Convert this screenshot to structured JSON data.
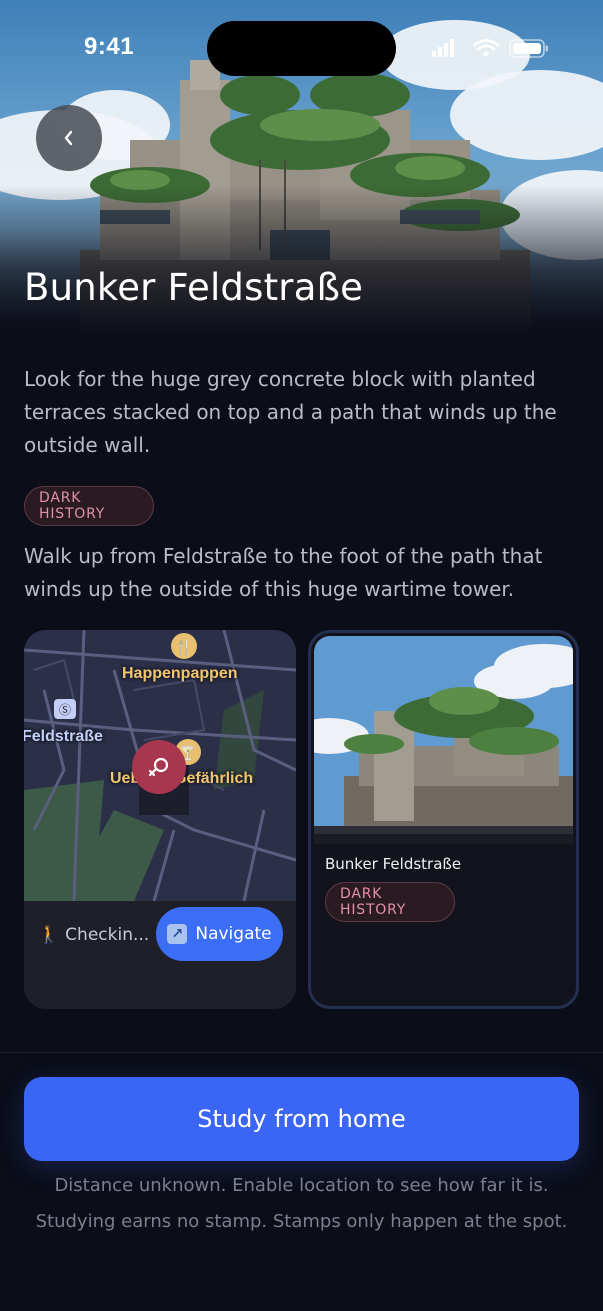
{
  "status_bar": {
    "time": "9:41"
  },
  "hero": {
    "title": "Bunker Feldstraße",
    "back_icon": "chevron-left-icon"
  },
  "description": "Look for the huge grey concrete block with planted terraces stacked on top and a path that winds up the outside wall.",
  "category_tag": "DARK HISTORY",
  "directions": "Walk up from Feldstraße to the foot of the path that winds up the outside of this huge wartime tower.",
  "map_card": {
    "labels": {
      "restaurant": "Happenpappen",
      "station": "Feldstraße",
      "bar": "Uebel & Gefährlich"
    },
    "checkin_label": "Checkin...",
    "navigate_label": "Navigate"
  },
  "photo_card": {
    "caption": "Bunker Feldstraße",
    "tag": "DARK HISTORY"
  },
  "cta": {
    "study_label": "Study from home",
    "footnote": "Distance unknown. Enable location to see how far it is. Studying earns no stamp. Stamps only happen at the spot."
  },
  "colors": {
    "background": "#0b0d18",
    "accent": "#3b66f5",
    "tag_text": "#e092a6",
    "tag_border": "#5c3a44",
    "map_pin": "#a8364f"
  }
}
